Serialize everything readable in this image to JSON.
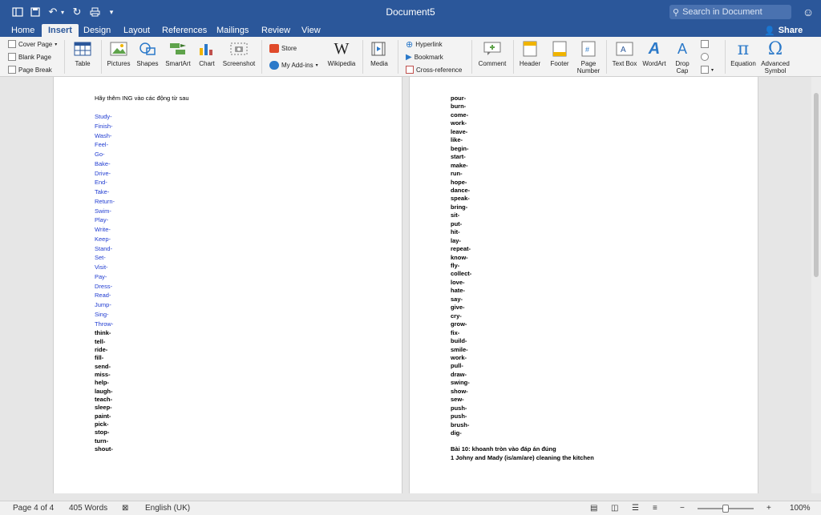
{
  "window": {
    "title": "Document5",
    "search_placeholder": "Search in Document"
  },
  "tabs": [
    "Home",
    "Insert",
    "Design",
    "Layout",
    "References",
    "Mailings",
    "Review",
    "View"
  ],
  "active_tab": "Insert",
  "share_label": "Share",
  "ribbon": {
    "pages": {
      "cover_page": "Cover Page",
      "blank_page": "Blank Page",
      "page_break": "Page Break"
    },
    "table": "Table",
    "pictures": "Pictures",
    "shapes": "Shapes",
    "smartart": "SmartArt",
    "chart": "Chart",
    "screenshot": "Screenshot",
    "store": "Store",
    "my_addins": "My Add-ins",
    "wikipedia": "Wikipedia",
    "media": "Media",
    "hyperlink": "Hyperlink",
    "bookmark": "Bookmark",
    "cross_reference": "Cross-reference",
    "comment": "Comment",
    "header": "Header",
    "footer": "Footer",
    "page_number_1": "Page",
    "page_number_2": "Number",
    "text_box": "Text Box",
    "wordart": "WordArt",
    "drop_cap_1": "Drop",
    "drop_cap_2": "Cap",
    "equation": "Equation",
    "advanced_symbol_1": "Advanced",
    "advanced_symbol_2": "Symbol"
  },
  "page_left": {
    "instruction": "Hãy thêm ING vào các động từ sau",
    "blue_words": [
      "Study-",
      "Finish-",
      "Wash-",
      "Feel-",
      "Go-",
      "Bake-",
      "Drive-",
      "End-",
      "Take-",
      "Return-",
      "Swim-",
      "Play-",
      "Write-",
      "Keep-",
      "Stand-",
      "Set-",
      "Visit-",
      "Pay-",
      "Dress-",
      "Read-",
      "Jump-",
      "Sing-",
      "Throw-"
    ],
    "black_words": [
      "think-",
      "tell-",
      "ride-",
      "fill-",
      "send-",
      "miss-",
      "help-",
      "laugh-",
      "teach-",
      "sleep-",
      "paint-",
      "pick-",
      "stop-",
      "turn-",
      "shout-"
    ]
  },
  "page_right": {
    "words": [
      "pour-",
      "burn-",
      "come-",
      "work-",
      "leave-",
      "like-",
      "begin-",
      "start-",
      "make-",
      "run-",
      "hope-",
      "dance-",
      "speak-",
      "bring-",
      "sit-",
      "put-",
      "hit-",
      "lay-",
      "repeat-",
      "know-",
      "fly-",
      "collect-",
      "love-",
      "hate-",
      "say-",
      "give-",
      "cry-",
      "grow-",
      "fix-",
      "build-",
      "smile-",
      "work-",
      "pull-",
      "draw-",
      "swing-",
      "show-",
      "sew-",
      "push-",
      "push-",
      "brush-",
      "dig-"
    ],
    "exercise_title": "Bài 10: khoanh tròn vào đáp án đúng",
    "exercise_line": "1 Johny and Mady (is/am/are) cleaning the kitchen"
  },
  "status": {
    "page": "Page 4 of 4",
    "words": "405 Words",
    "language": "English (UK)",
    "zoom": "100%",
    "zoom_minus": "−",
    "zoom_plus": "+"
  },
  "colors": {
    "title_bar": "#2b579a",
    "blue_text": "#1f3bd1"
  }
}
